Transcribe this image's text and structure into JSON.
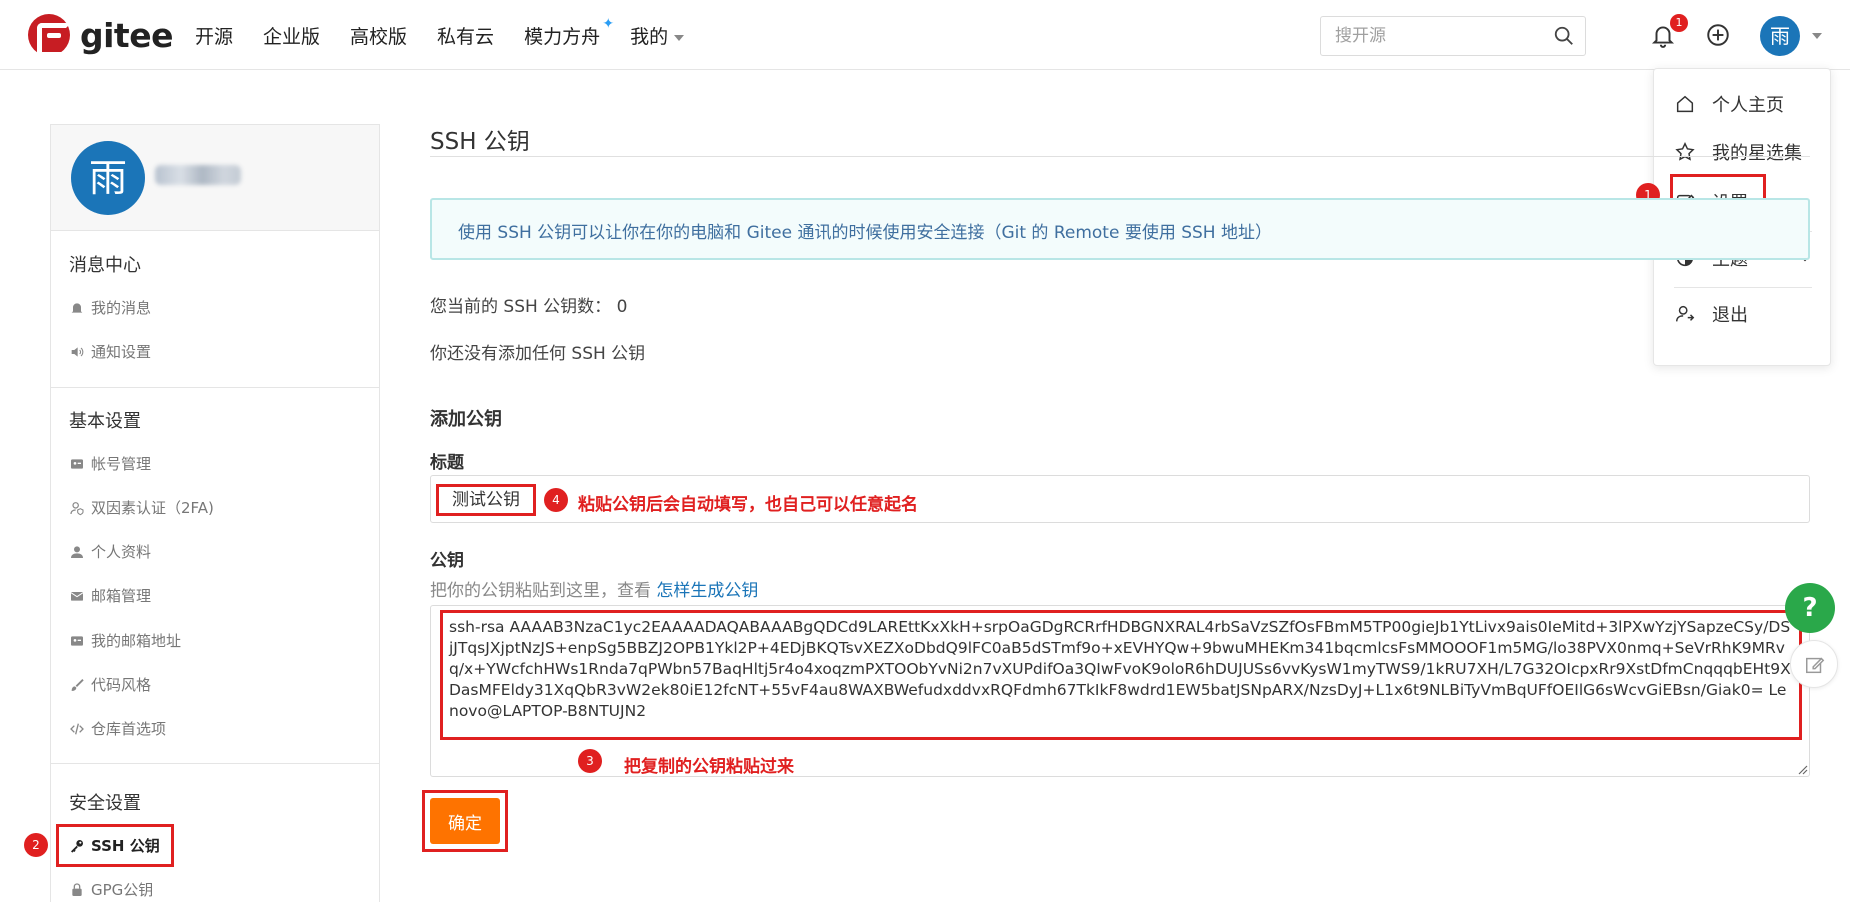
{
  "header": {
    "logo_text": "gitee",
    "nav": [
      "开源",
      "企业版",
      "高校版",
      "私有云",
      "模力方舟",
      "我的"
    ],
    "search_placeholder": "搜开源",
    "notification_count": "1",
    "avatar_char": "雨"
  },
  "dropdown": {
    "items": [
      {
        "label": "个人主页",
        "icon": "home-icon"
      },
      {
        "label": "我的星选集",
        "icon": "star-icon"
      },
      {
        "label": "设置",
        "icon": "edit-icon"
      },
      {
        "label": "主题",
        "icon": "contrast-icon"
      },
      {
        "label": "退出",
        "icon": "logout-icon"
      }
    ]
  },
  "steps": [
    "1",
    "2",
    "3",
    "4"
  ],
  "sidebar": {
    "avatar_char": "雨",
    "sections": [
      {
        "title": "消息中心",
        "items": [
          "我的消息",
          "通知设置"
        ]
      },
      {
        "title": "基本设置",
        "items": [
          "帐号管理",
          "双因素认证（2FA)",
          "个人资料",
          "邮箱管理",
          "我的邮箱地址",
          "代码风格",
          "仓库首选项"
        ]
      },
      {
        "title": "安全设置",
        "items": [
          "SSH 公钥",
          "GPG公钥"
        ]
      }
    ]
  },
  "main": {
    "title": "SSH 公钥",
    "notice": "使用 SSH 公钥可以让你在你的电脑和 Gitee 通讯的时候使用安全连接（Git 的 Remote 要使用 SSH 地址）",
    "count_text": "您当前的 SSH 公钥数： 0",
    "empty_text": "你还没有添加任何 SSH 公钥",
    "add_heading": "添加公钥",
    "title_label": "标题",
    "title_value": "测试公钥",
    "annotation_4": "粘贴公钥后会自动填写，也自己可以任意起名",
    "key_label": "公钥",
    "key_hint": "把你的公钥粘贴到这里，查看 ",
    "key_hint_link": "怎样生成公钥",
    "key_value": "ssh-rsa AAAAB3NzaC1yc2EAAAADAQABAAABgQDCd9LAREttKxXkH+srpOaGDgRCRrfHDBGNXRAL4rbSaVzSZfOsFBmM5TP00gieJb1YtLivx9ais0IeMitd+3lPXwYzjYSapzeCSy/DSjJTqsJXjptNzJS+enpSg5BBZJ2OPB1Ykl2P+4EDjBKQTsvXEZXoDbdQ9lFC0aB5dSTmf9o+xEVHYQw+9bwuMHEKm341bqcmlcsFsMMOOOF1m5MG/lo38PVX0nmq+SeVrRhK9MRvq/x+YWcfchHWs1Rnda7qPWbn57BaqHltj5r4o4xoqzmPXTOObYvNi2n7vXUPdifOa3QIwFvoK9oloR6hDUJUSs6vvKysW1myTWS9/1kRU7XH/L7G32OIcpxRr9XstDfmCnqqqbEHt9XDasMFEldy31XqQbR3vW2ek80iE12fcNT+55vF4au8WAXBWefudxddvxRQFdmh67TkIkF8wdrd1EW5batJSNpARX/NzsDyJ+L1x6t9NLBiTyVmBqUFfOEIlG6sWcvGiEBsn/Giak0= Lenovo@LAPTOP-B8NTUJN2",
    "annotation_3": "把复制的公钥粘贴过来",
    "confirm_label": "确定"
  },
  "floating": {
    "help": "?"
  }
}
